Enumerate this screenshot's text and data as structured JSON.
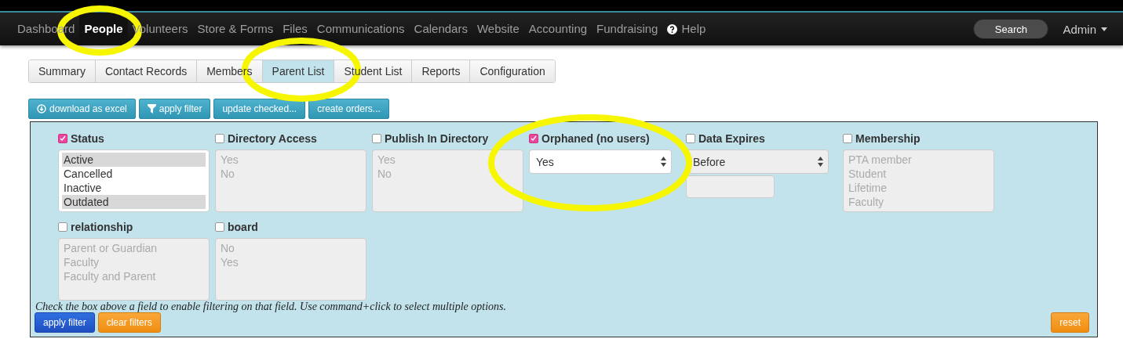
{
  "nav": {
    "items": [
      {
        "label": "Dashboard",
        "selected": false
      },
      {
        "label": "People",
        "selected": true
      },
      {
        "label": "Volunteers",
        "selected": false
      },
      {
        "label": "Store & Forms",
        "selected": false
      },
      {
        "label": "Files",
        "selected": false
      },
      {
        "label": "Communications",
        "selected": false
      },
      {
        "label": "Calendars",
        "selected": false
      },
      {
        "label": "Website",
        "selected": false
      },
      {
        "label": "Accounting",
        "selected": false
      },
      {
        "label": "Fundraising",
        "selected": false
      },
      {
        "label": "Help",
        "selected": false,
        "kind": "help"
      }
    ],
    "search": {
      "placeholder": "Search"
    },
    "user": "Admin"
  },
  "tabs": [
    {
      "label": "Summary",
      "selected": false
    },
    {
      "label": "Contact Records",
      "selected": false
    },
    {
      "label": "Members",
      "selected": false
    },
    {
      "label": "Parent List",
      "selected": true
    },
    {
      "label": "Student List",
      "selected": false
    },
    {
      "label": "Reports",
      "selected": false
    },
    {
      "label": "Configuration",
      "selected": false
    }
  ],
  "actions": [
    {
      "label": "download as excel",
      "kind": "download"
    },
    {
      "label": "apply filter",
      "kind": "filter"
    },
    {
      "label": "update checked...",
      "kind": "plain"
    },
    {
      "label": "create orders...",
      "kind": "plain"
    }
  ],
  "filters": {
    "rows": [
      [
        {
          "label": "Status",
          "checked": true,
          "kind": "listbox",
          "options": [
            {
              "label": "Active",
              "selected": true
            },
            {
              "label": "Cancelled",
              "selected": false
            },
            {
              "label": "Inactive",
              "selected": false
            },
            {
              "label": "Outdated",
              "selected": true
            }
          ]
        },
        {
          "label": "Directory Access",
          "checked": false,
          "kind": "listbox",
          "options": [
            {
              "label": "Yes",
              "selected": false
            },
            {
              "label": "No",
              "selected": false
            }
          ]
        },
        {
          "label": "Publish In Directory",
          "checked": false,
          "kind": "listbox",
          "options": [
            {
              "label": "Yes",
              "selected": false
            },
            {
              "label": "No",
              "selected": false
            }
          ]
        },
        {
          "label": "Orphaned (no users)",
          "checked": true,
          "kind": "select",
          "value": "Yes"
        },
        {
          "label": "Data Expires",
          "checked": false,
          "kind": "date",
          "value": "Before"
        },
        {
          "label": "Membership",
          "checked": false,
          "kind": "listbox",
          "options": [
            {
              "label": "PTA member",
              "selected": false
            },
            {
              "label": "Student",
              "selected": false
            },
            {
              "label": "Lifetime",
              "selected": false
            },
            {
              "label": "Faculty",
              "selected": false
            }
          ]
        }
      ],
      [
        {
          "label": "relationship",
          "checked": false,
          "kind": "listbox",
          "options": [
            {
              "label": "Parent or Guardian",
              "selected": false
            },
            {
              "label": "Faculty",
              "selected": false
            },
            {
              "label": "Faculty and Parent",
              "selected": false
            }
          ]
        },
        {
          "label": "board",
          "checked": false,
          "kind": "listbox",
          "options": [
            {
              "label": "No",
              "selected": false
            },
            {
              "label": "Yes",
              "selected": false
            }
          ]
        }
      ]
    ],
    "hint": "Check the box above a field to enable filtering on that field. Use command+click to select multiple options.",
    "apply": "apply filter",
    "clear": "clear filters",
    "reset": "reset"
  }
}
